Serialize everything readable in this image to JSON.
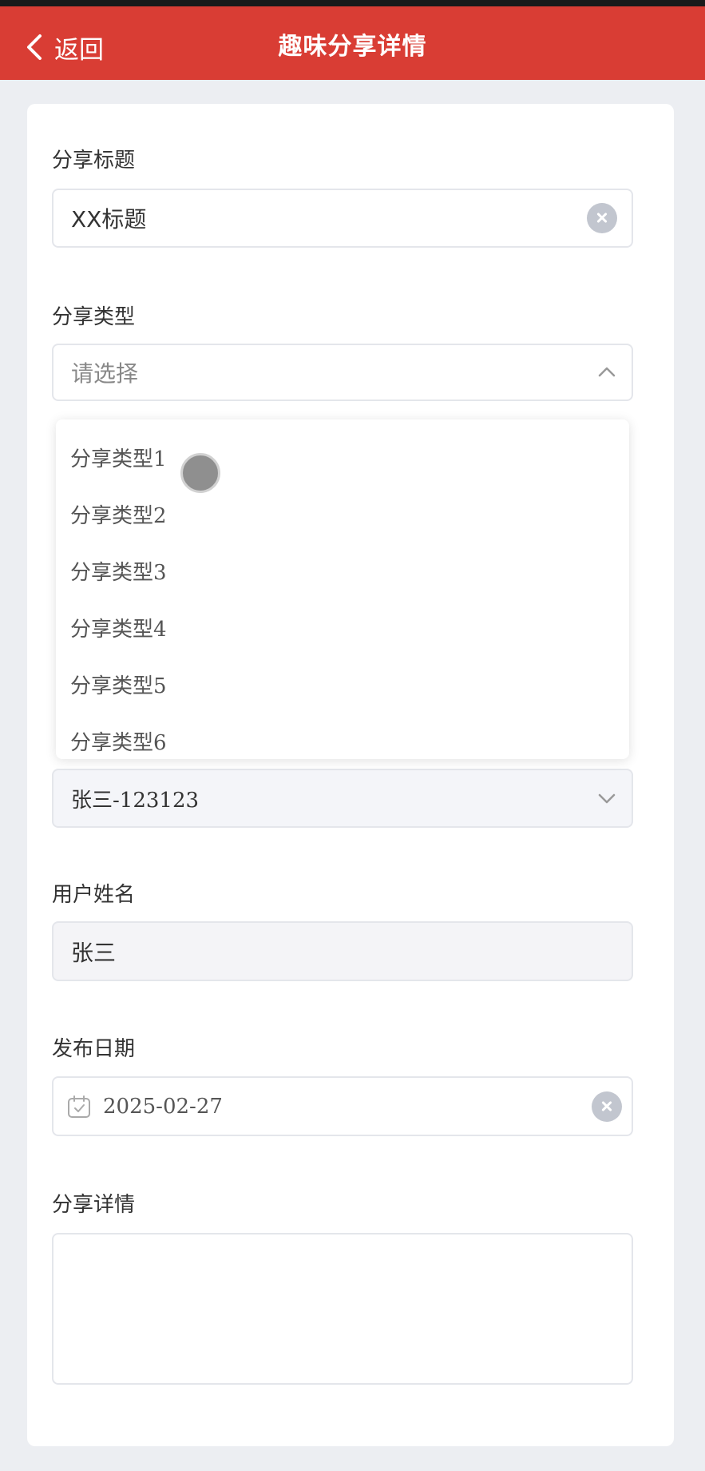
{
  "header": {
    "back_label": "返回",
    "title": "趣味分享详情",
    "color": "#d93d34"
  },
  "form": {
    "title": {
      "label": "分享标题",
      "value": "XX标题"
    },
    "type": {
      "label": "分享类型",
      "placeholder": "请选择",
      "options": [
        "分享类型1",
        "分享类型2",
        "分享类型3",
        "分享类型4",
        "分享类型5",
        "分享类型6"
      ]
    },
    "user": {
      "value": "张三-123123"
    },
    "username": {
      "label": "用户姓名",
      "value": "张三"
    },
    "date": {
      "label": "发布日期",
      "value": "2025-02-27"
    },
    "detail": {
      "label": "分享详情",
      "value": ""
    }
  },
  "icons": {
    "back": "chevron-left-icon",
    "clear": "clear-icon",
    "dropdown_open": "chevron-up-icon",
    "dropdown_closed": "chevron-down-icon",
    "calendar": "calendar-icon"
  }
}
